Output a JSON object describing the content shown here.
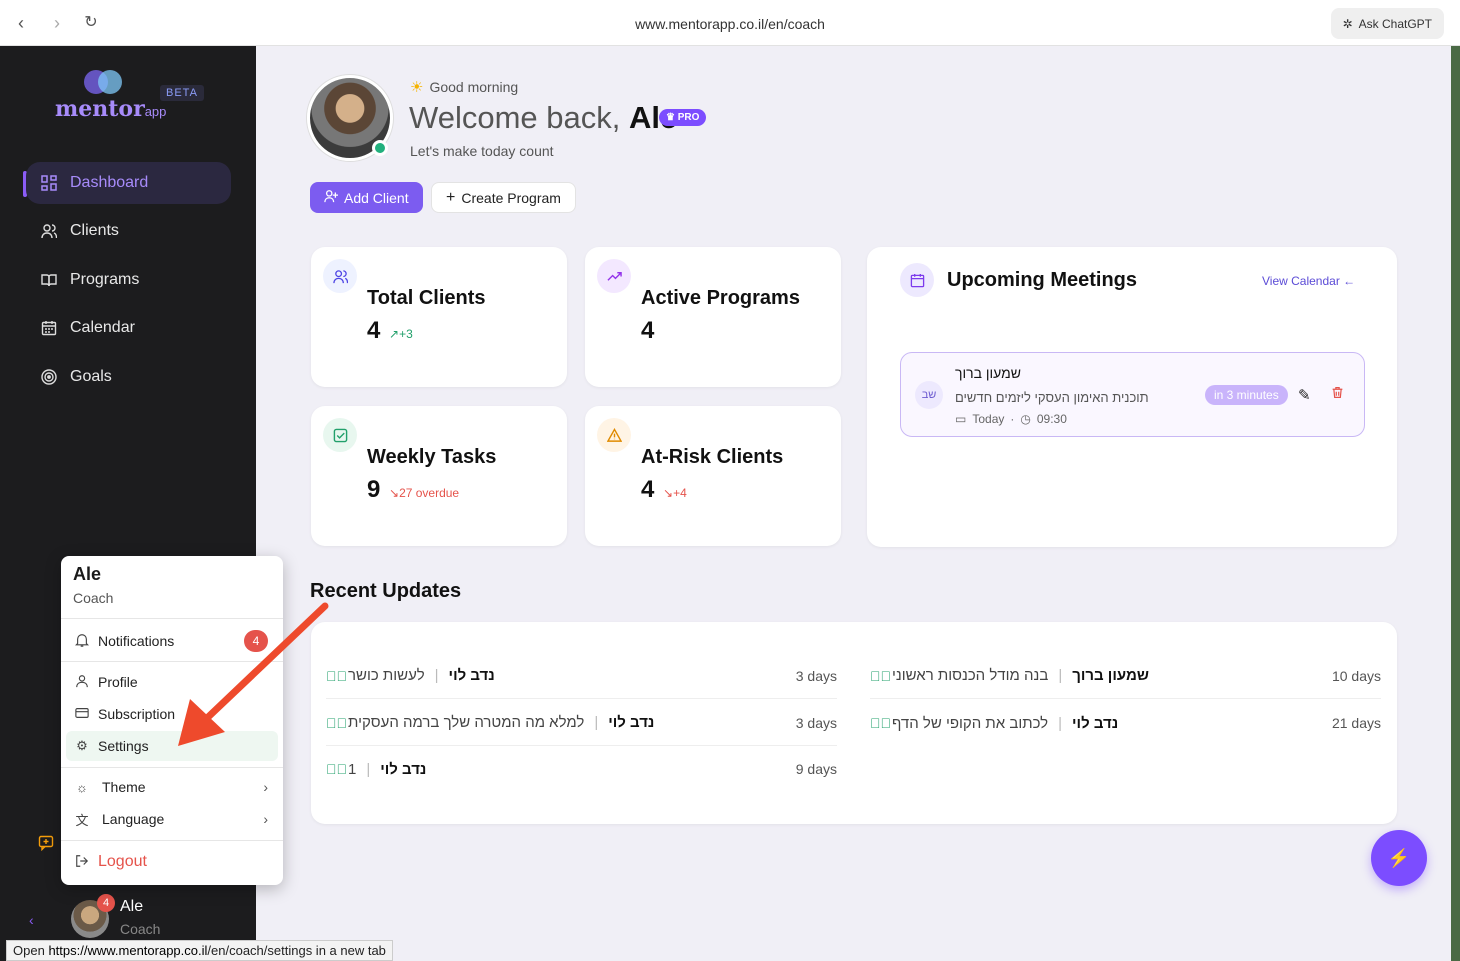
{
  "browser": {
    "url": "www.mentorapp.co.il/en/coach",
    "ask_label": "Ask ChatGPT",
    "status_prefix": "Open",
    "status_url": "https://www.mentorapp.co.il",
    "status_suffix": "/en/coach/settings in a new tab"
  },
  "sidebar": {
    "logo_main": "mentor",
    "logo_suffix": "app",
    "beta": "BETA",
    "items": [
      {
        "label": "Dashboard",
        "icon": "grid-icon"
      },
      {
        "label": "Clients",
        "icon": "users-icon"
      },
      {
        "label": "Programs",
        "icon": "book-icon"
      },
      {
        "label": "Calendar",
        "icon": "calendar-icon"
      },
      {
        "label": "Goals",
        "icon": "target-icon"
      }
    ],
    "user_name": "Ale",
    "user_role": "Coach",
    "user_badge": "4"
  },
  "header": {
    "greeting": "Good morning",
    "welcome_prefix": "Welcome back,",
    "welcome_name": "Ale",
    "pro": "PRO",
    "subtitle": "Let's make today count",
    "add_client": "Add Client",
    "create_program": "Create Program"
  },
  "stats": {
    "total_clients": {
      "title": "Total Clients",
      "value": "4",
      "delta": "+3"
    },
    "active_programs": {
      "title": "Active Programs",
      "value": "4"
    },
    "weekly_tasks": {
      "title": "Weekly Tasks",
      "value": "9",
      "delta": "27 overdue"
    },
    "at_risk": {
      "title": "At-Risk Clients",
      "value": "4",
      "delta": "+4"
    }
  },
  "meetings": {
    "title": "Upcoming Meetings",
    "view_calendar": "View Calendar",
    "item": {
      "initials": "שב",
      "name": "שמעון ברוך",
      "program": "תוכנית האימון העסקי ליזמים חדשים",
      "day": "Today",
      "time": "09:30",
      "badge": "in 3 minutes"
    }
  },
  "updates": {
    "title": "Recent Updates",
    "left": [
      {
        "name": "נדב לוי",
        "task": "לעשות כושר",
        "days": "3 days"
      },
      {
        "name": "נדב לוי",
        "task": "למלא מה המטרה שלך ברמה העסקית",
        "days": "3 days"
      },
      {
        "name": "נדב לוי",
        "task": "1",
        "days": "9 days"
      }
    ],
    "right": [
      {
        "name": "שמעון ברוך",
        "task": "בנה מודל הכנסות ראשוני",
        "days": "10 days"
      },
      {
        "name": "נדב לוי",
        "task": "לכתוב את הקופי של הדף",
        "days": "21 days"
      }
    ]
  },
  "popup": {
    "name": "Ale",
    "role": "Coach",
    "notifications": "Notifications",
    "notif_count": "4",
    "profile": "Profile",
    "subscription": "Subscription",
    "settings": "Settings",
    "theme": "Theme",
    "language": "Language",
    "logout": "Logout"
  },
  "colors": {
    "accent": "#7c4dff",
    "sidebar": "#1c1c1e",
    "danger": "#e5534b",
    "success": "#22a06b"
  }
}
